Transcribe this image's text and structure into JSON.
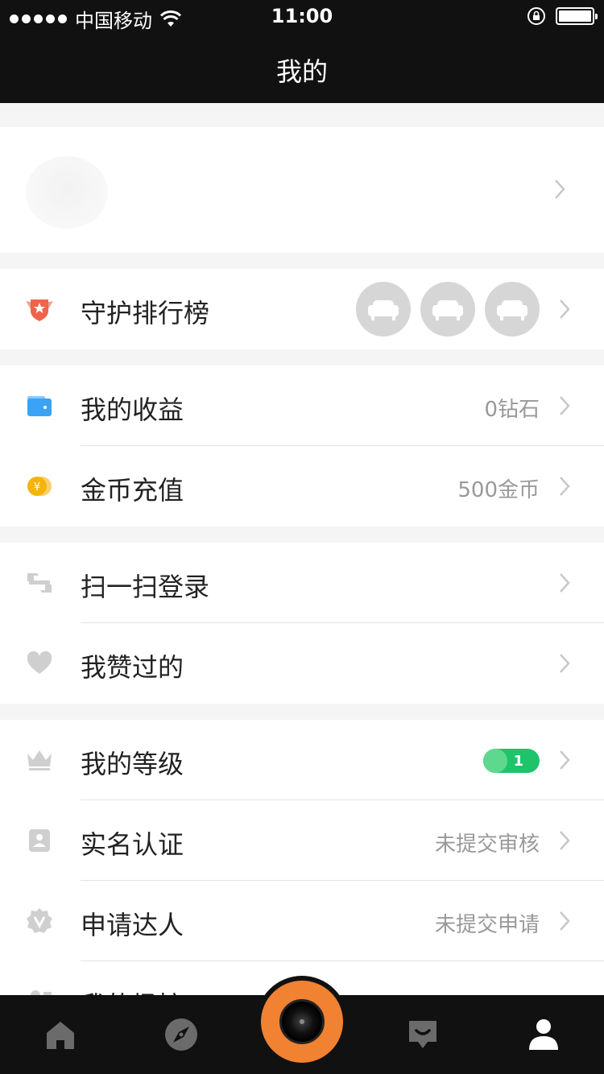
{
  "status_bar": {
    "carrier": "中国移动",
    "time": "11:00"
  },
  "nav": {
    "title": "我的"
  },
  "guard_rank": {
    "label": "守护排行榜",
    "icon": "shield-star-icon"
  },
  "earnings": {
    "label": "我的收益",
    "value": "0钻石",
    "icon": "wallet-icon"
  },
  "coins": {
    "label": "金币充值",
    "value": "500金币",
    "icon": "coin-icon"
  },
  "scan_login": {
    "label": "扫一扫登录",
    "icon": "scan-icon"
  },
  "liked": {
    "label": "我赞过的",
    "icon": "heart-icon"
  },
  "level": {
    "label": "我的等级",
    "badge": "1",
    "icon": "crown-icon",
    "badge_color": "#1fc36a"
  },
  "verification": {
    "label": "实名认证",
    "value": "未提交审核",
    "icon": "id-card-icon"
  },
  "talent": {
    "label": "申请达人",
    "value": "未提交申请",
    "icon": "v-badge-icon"
  },
  "partial_row": {
    "label": "我的场控"
  },
  "tabs": [
    {
      "name": "home",
      "icon": "home-icon"
    },
    {
      "name": "discover",
      "icon": "compass-icon"
    },
    {
      "name": "live",
      "icon": "camera-icon"
    },
    {
      "name": "messages",
      "icon": "chat-icon"
    },
    {
      "name": "profile",
      "icon": "user-icon"
    }
  ],
  "colors": {
    "bar_bg": "#111111",
    "accent_orange": "#f08232",
    "wallet_blue": "#3aa3f5",
    "coin_yellow": "#f5b40c",
    "shield_red": "#f0644b"
  }
}
